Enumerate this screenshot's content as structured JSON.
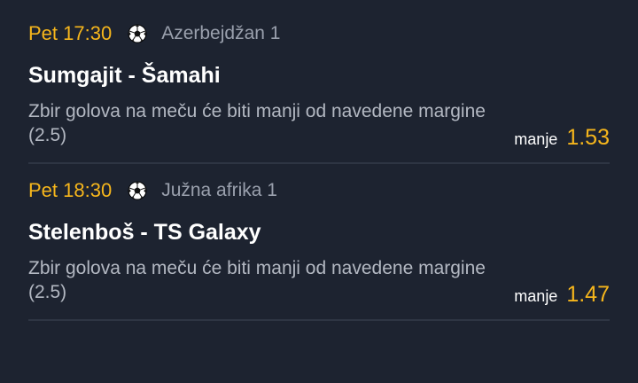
{
  "matches": [
    {
      "time": "Pet 17:30",
      "sport_icon": "soccer-ball-icon",
      "league": "Azerbejdžan 1",
      "teams": "Sumgajit - Šamahi",
      "market": "Zbir golova na meču će biti manji od navedene margine (2.5)",
      "selection": "manje",
      "odd": "1.53"
    },
    {
      "time": "Pet 18:30",
      "sport_icon": "soccer-ball-icon",
      "league": "Južna afrika 1",
      "teams": "Stelenboš - TS Galaxy",
      "market": "Zbir golova na meču će biti manji od navedene margine (2.5)",
      "selection": "manje",
      "odd": "1.47"
    }
  ],
  "colors": {
    "background": "#1d2330",
    "accent": "#f6b61c",
    "muted_text": "#9aa0ad",
    "divider": "#2e3543"
  }
}
